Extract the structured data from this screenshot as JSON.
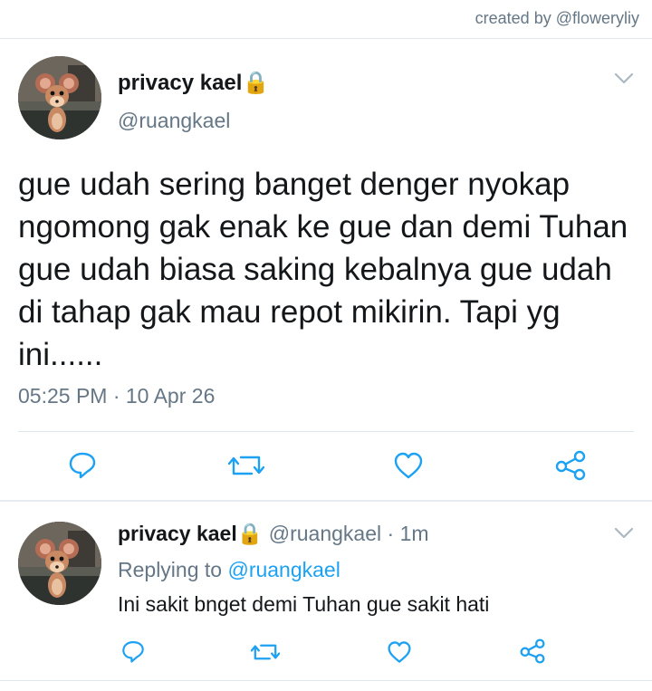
{
  "credit": "created by @floweryliy",
  "tweet": {
    "display_name": "privacy kael",
    "lock_emoji": "🔒",
    "handle": "@ruangkael",
    "text": "gue udah sering banget denger nyokap ngomong gak enak ke gue dan demi Tuhan gue udah biasa saking kebalnya gue udah di tahap gak mau repot mikirin. Tapi yg ini......",
    "timestamp": "05:25 PM · 10 Apr 26"
  },
  "reply": {
    "display_name": "privacy kael",
    "lock_emoji": "🔒",
    "handle": "@ruangkael",
    "time_ago": "· 1m",
    "replying_prefix": "Replying to",
    "replying_handle": "@ruangkael",
    "text": "Ini sakit bnget demi Tuhan gue sakit hati"
  },
  "colors": {
    "accent": "#1da1f2",
    "secondary_text": "#657786",
    "divider": "#e1e8ed",
    "icon": "#1da1f2"
  },
  "icons": [
    "lock-icon",
    "chevron-down-icon",
    "reply-icon",
    "retweet-icon",
    "like-icon",
    "share-icon",
    "avatar-mouse"
  ]
}
